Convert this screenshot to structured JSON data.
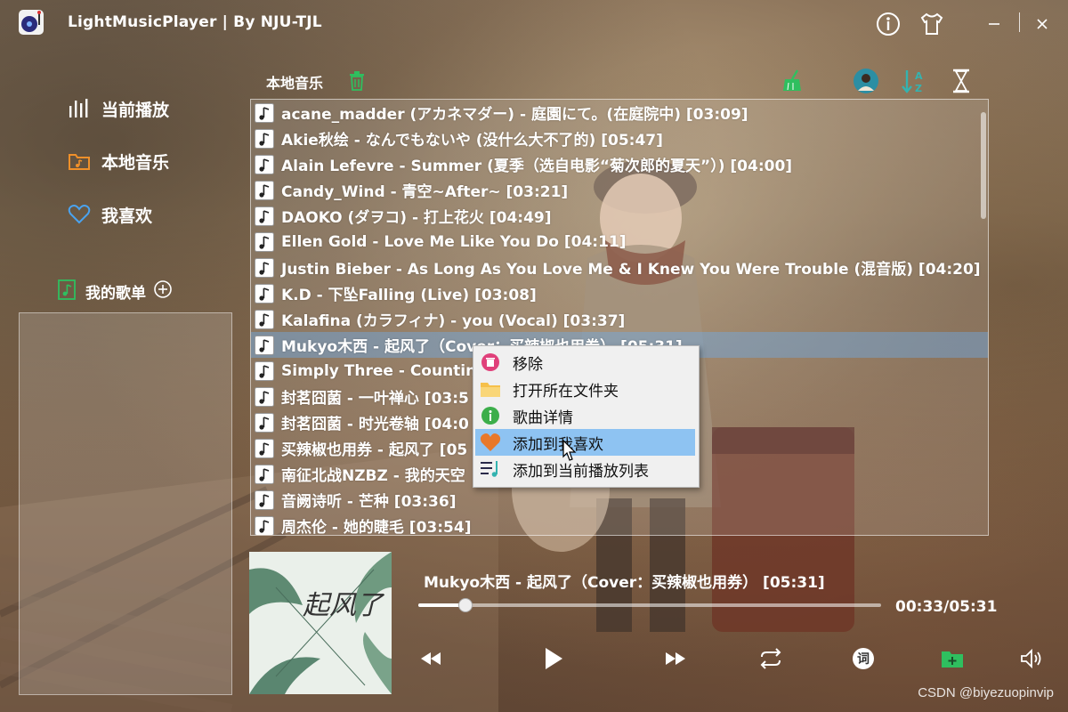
{
  "app": {
    "title": "LightMusicPlayer | By NJU-TJL"
  },
  "sidebar": {
    "items": [
      {
        "label": "当前播放",
        "icon": "bars-icon"
      },
      {
        "label": "本地音乐",
        "icon": "folder-music-icon"
      },
      {
        "label": "我喜欢",
        "icon": "heart-icon"
      }
    ],
    "playlists_label": "我的歌单"
  },
  "list": {
    "title": "本地音乐",
    "songs": [
      "acane_madder (アカネマダー) - 庭園にて。(在庭院中) [03:09]",
      "Akie秋绘 - なんでもないや (没什么大不了的) [05:47]",
      "Alain Lefevre - Summer (夏季（选自电影“菊次郎的夏天”）) [04:00]",
      "Candy_Wind - 青空~After~ [03:21]",
      "DAOKO (ダヲコ) - 打上花火 [04:49]",
      "Ellen Gold - Love Me Like You Do [04:11]",
      "Justin Bieber - As Long As You Love Me & I Knew You Were Trouble (混音版) [04:20]",
      "K.D - 下坠Falling (Live) [03:08]",
      "Kalafina (カラフィナ) - you (Vocal) [03:37]",
      "Mukyo木西 - 起风了（Cover：买辣椒也用券） [05:31]",
      "Simply Three - Counting",
      "封茗囧菌 - 一叶禅心 [03:5",
      "封茗囧菌 - 时光卷轴 [04:0",
      "买辣椒也用券 - 起风了 [05",
      "南征北战NZBZ - 我的天空",
      "音阙诗听 - 芒种 [03:36]",
      "周杰伦 - 她的睫毛 [03:54]"
    ],
    "selected_index": 9
  },
  "context_menu": {
    "items": [
      {
        "label": "移除",
        "icon": "trash-icon"
      },
      {
        "label": "打开所在文件夹",
        "icon": "folder-icon"
      },
      {
        "label": "歌曲详情",
        "icon": "info-icon"
      },
      {
        "label": "添加到我喜欢",
        "icon": "heart-icon"
      },
      {
        "label": "添加到当前播放列表",
        "icon": "add-to-playlist-icon"
      }
    ],
    "hover_index": 3
  },
  "player": {
    "now_playing": "Mukyo木西 - 起风了（Cover：买辣椒也用券） [05:31]",
    "time": "00:33/05:31",
    "progress": 0.1,
    "cover_text": "起风了"
  },
  "colors": {
    "accent_green": "#2fbf5f",
    "teal": "#34b3b0",
    "orange": "#f0902a",
    "blue": "#4aa3f0",
    "menu_hover": "#8ec3f2"
  },
  "watermark": "CSDN @biyezuopinvip"
}
